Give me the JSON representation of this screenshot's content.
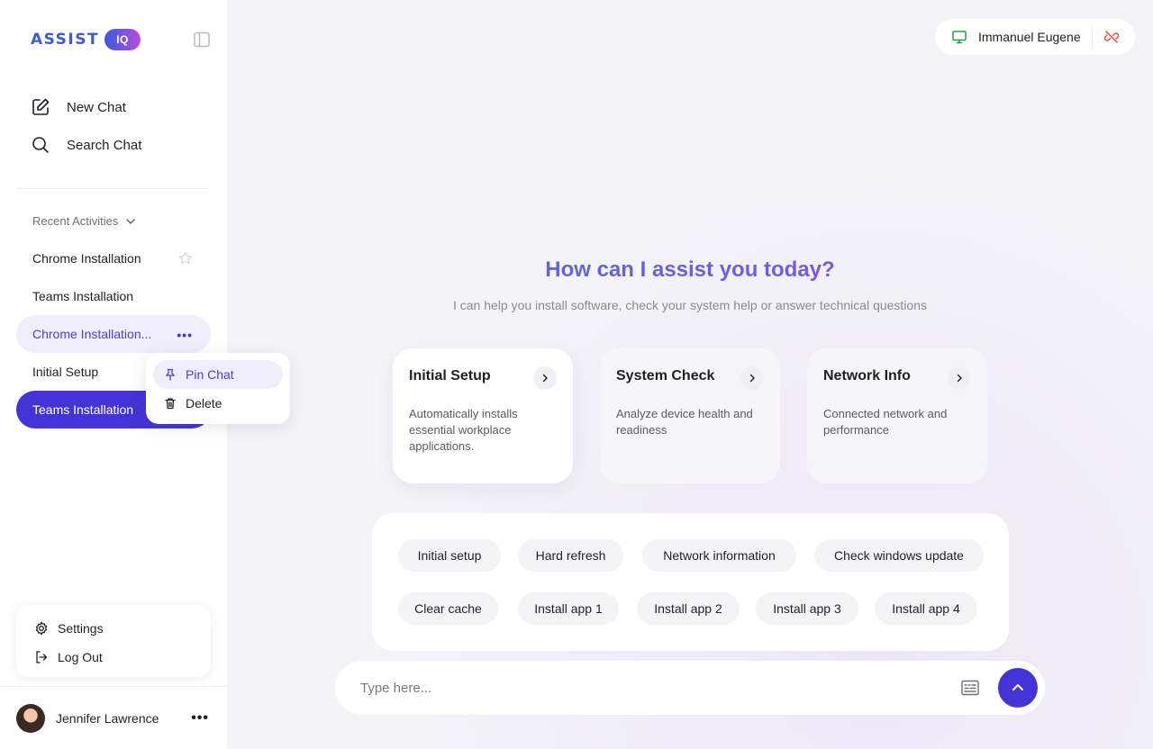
{
  "brand": {
    "logo_text": "ASSIST",
    "logo_badge": "IQ"
  },
  "nav": {
    "new_chat": "New Chat",
    "search_chat": "Search Chat"
  },
  "recent": {
    "header": "Recent Activities",
    "items": [
      {
        "label": "Chrome Installation"
      },
      {
        "label": "Teams Installation"
      },
      {
        "label": "Chrome Installation..."
      },
      {
        "label": "Initial Setup"
      },
      {
        "label": "Teams Installation"
      }
    ]
  },
  "context_menu": {
    "pin": "Pin Chat",
    "delete": "Delete"
  },
  "bottom_menu": {
    "settings": "Settings",
    "logout": "Log Out"
  },
  "user": {
    "name": "Jennifer Lawrence"
  },
  "device": {
    "name": "Immanuel Eugene"
  },
  "hero": {
    "title": "How can I assist you today?",
    "subtitle": "I can help you install software, check your system help or answer technical questions"
  },
  "cards": [
    {
      "title": "Initial Setup",
      "desc": "Automatically installs essential workplace applications."
    },
    {
      "title": "System Check",
      "desc": "Analyze device health and readiness"
    },
    {
      "title": "Network Info",
      "desc": "Connected network and performance"
    }
  ],
  "chips": [
    "Initial setup",
    "Hard refresh",
    "Network information",
    "Check windows update",
    "Clear cache",
    "Install app 1",
    "Install app 2",
    "Install app 3",
    "Install app 4"
  ],
  "input": {
    "placeholder": "Type here..."
  },
  "colors": {
    "accent": "#4434d8",
    "accent_soft": "#f0eefc",
    "title_gradient_start": "#3a6ee8",
    "title_gradient_end": "#9b4ee0"
  }
}
